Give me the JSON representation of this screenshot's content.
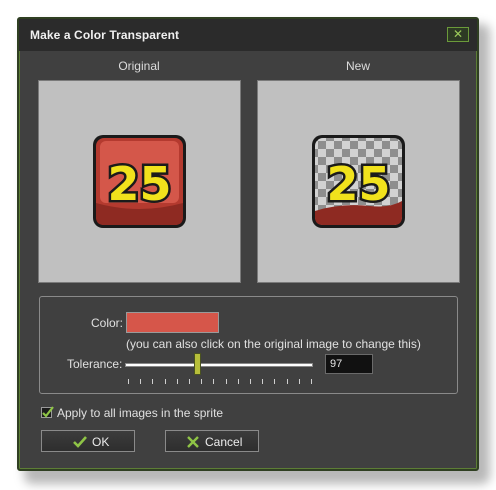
{
  "window": {
    "title": "Make a Color Transparent",
    "close_glyph": "✕"
  },
  "preview": {
    "original_label": "Original",
    "new_label": "New",
    "sprite_text": "25"
  },
  "settings": {
    "color_label": "Color:",
    "color_value": "#d6564a",
    "color_hint": "(you can also click on the original image to change this)",
    "tolerance_label": "Tolerance:",
    "tolerance_value": "97"
  },
  "options": {
    "apply_all_label": "Apply to all images in the sprite",
    "apply_all_checked": true
  },
  "buttons": {
    "ok_label": "OK",
    "cancel_label": "Cancel"
  },
  "colors": {
    "window_bg": "#404040",
    "accent_green": "#8fc446",
    "sprite_red": "#c24236",
    "sprite_yellow": "#f1e21c"
  },
  "icons": {
    "close": "close-icon",
    "ok": "checkmark-icon",
    "cancel": "cross-icon",
    "check": "checkbox-check-icon"
  }
}
